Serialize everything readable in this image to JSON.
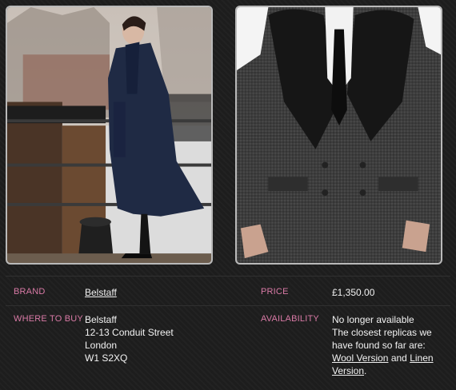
{
  "images": {
    "left": {
      "alt_icon": "coat-photo-sherlock"
    },
    "right": {
      "alt_icon": "coat-photo-runway"
    }
  },
  "details": {
    "brand_label": "BRAND",
    "brand_value": "Belstaff",
    "price_label": "PRICE",
    "price_value": "£1,350.00",
    "where_label": "WHERE TO BUY",
    "where_lines": [
      "Belstaff",
      "12-13 Conduit Street",
      "London",
      "W1 S2XQ"
    ],
    "availability_label": "AVAILABILITY",
    "availability_status": "No longer available",
    "availability_text_1": "The closest replicas we",
    "availability_text_2": "have found so far are:",
    "wool_link": "Wool Version",
    "and_text": " and ",
    "linen_link": "Linen",
    "linen_link_2": "Version",
    "period": "."
  },
  "colors": {
    "label": "#d97aa6",
    "text": "#f2f2f2",
    "background": "#1d1d1d"
  }
}
